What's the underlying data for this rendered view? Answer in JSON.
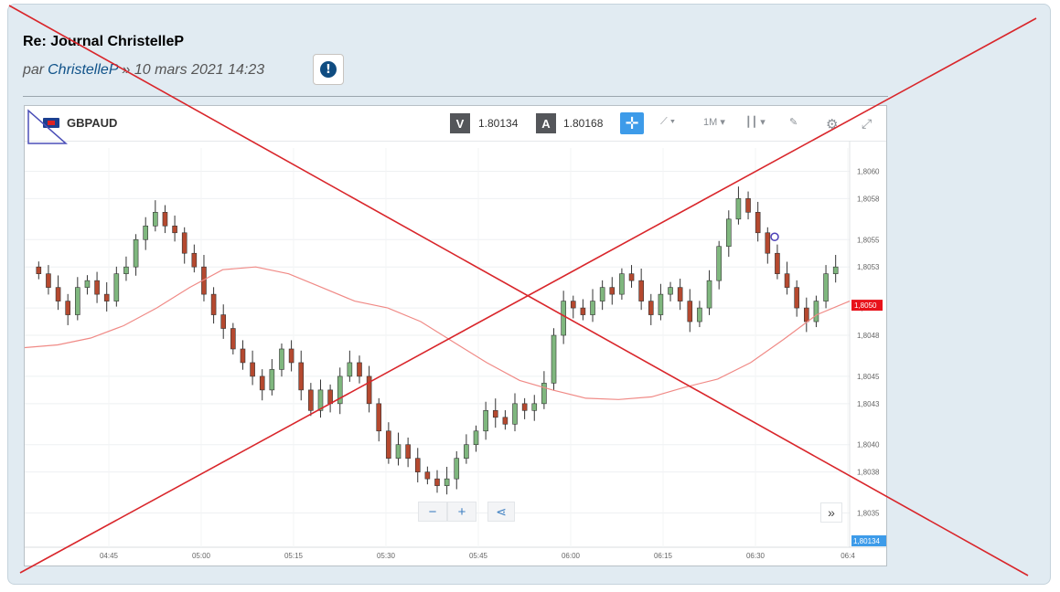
{
  "post": {
    "title": "Re: Journal ChristelleP",
    "by_prefix": "par",
    "author": "ChristelleP",
    "date": "» 10 mars 2021 14:23",
    "report_icon": "exclamation-icon"
  },
  "toolbar": {
    "symbol": "GBPAUD",
    "bid_label": "V",
    "bid_value": "1.80134",
    "ask_label": "A",
    "ask_value": "1.80168",
    "timeframe": "1M",
    "icons": [
      "crosshair-icon",
      "line-chart-icon",
      "candlestick-icon",
      "draw-icon",
      "gear-icon",
      "expand-icon"
    ]
  },
  "controls": {
    "zoom_out": "−",
    "zoom_in": "+",
    "forward": "»"
  },
  "chart_data": {
    "type": "candlestick",
    "title": "GBPAUD",
    "x_ticks": [
      "04:45",
      "05:00",
      "05:15",
      "05:30",
      "05:45",
      "06:00",
      "06:15",
      "06:30",
      "06:4"
    ],
    "y_ticks": [
      "1,8060",
      "1,8058",
      "1,8055",
      "1,8053",
      "1,8050",
      "1,8048",
      "1,8045",
      "1,8043",
      "1,8040",
      "1,8038",
      "1,8035"
    ],
    "ylim": [
      1.80335,
      1.80617
    ],
    "current_price_label": "1,8050",
    "bottom_price_label": "1,80134",
    "series": [
      {
        "name": "candles",
        "close_path": [
          1.80525,
          1.80515,
          1.80505,
          1.80495,
          1.80515,
          1.8052,
          1.8051,
          1.80505,
          1.80525,
          1.8053,
          1.8055,
          1.8056,
          1.8057,
          1.8056,
          1.80555,
          1.8054,
          1.8053,
          1.8051,
          1.80495,
          1.80485,
          1.8047,
          1.8046,
          1.8045,
          1.8044,
          1.80455,
          1.8047,
          1.8046,
          1.8044,
          1.80425,
          1.8044,
          1.8043,
          1.8045,
          1.8046,
          1.8045,
          1.8043,
          1.8041,
          1.8039,
          1.804,
          1.8039,
          1.8038,
          1.80375,
          1.8037,
          1.80375,
          1.8039,
          1.804,
          1.8041,
          1.80425,
          1.8042,
          1.80415,
          1.8043,
          1.80425,
          1.8043,
          1.80445,
          1.8048,
          1.80505,
          1.805,
          1.80495,
          1.80505,
          1.80515,
          1.8051,
          1.80525,
          1.8052,
          1.80505,
          1.80495,
          1.8051,
          1.80515,
          1.80505,
          1.8049,
          1.805,
          1.8052,
          1.80545,
          1.80565,
          1.8058,
          1.8057,
          1.80555,
          1.8054,
          1.80525,
          1.80515,
          1.805,
          1.8049,
          1.80505,
          1.80525,
          1.8053
        ]
      },
      {
        "name": "moving-average",
        "values": [
          1.80471,
          1.80473,
          1.80478,
          1.80487,
          1.805,
          1.80515,
          1.80528,
          1.8053,
          1.80525,
          1.80515,
          1.80505,
          1.805,
          1.8049,
          1.80475,
          1.8046,
          1.80447,
          1.8044,
          1.80434,
          1.80433,
          1.80435,
          1.80442,
          1.80448,
          1.8046,
          1.80477,
          1.80495,
          1.80505
        ]
      }
    ]
  },
  "colors": {
    "up": "#7fb77e",
    "down": "#b5492f",
    "ma": "#f08a86",
    "cross_lines": "#d9262b",
    "current_price_bg": "#e8121a",
    "bottom_price_bg": "#3d9be9",
    "marker": "#4b3fb8"
  },
  "overlay": {
    "kind": "big-red-x",
    "corner_triangle": "blue-triangle"
  }
}
